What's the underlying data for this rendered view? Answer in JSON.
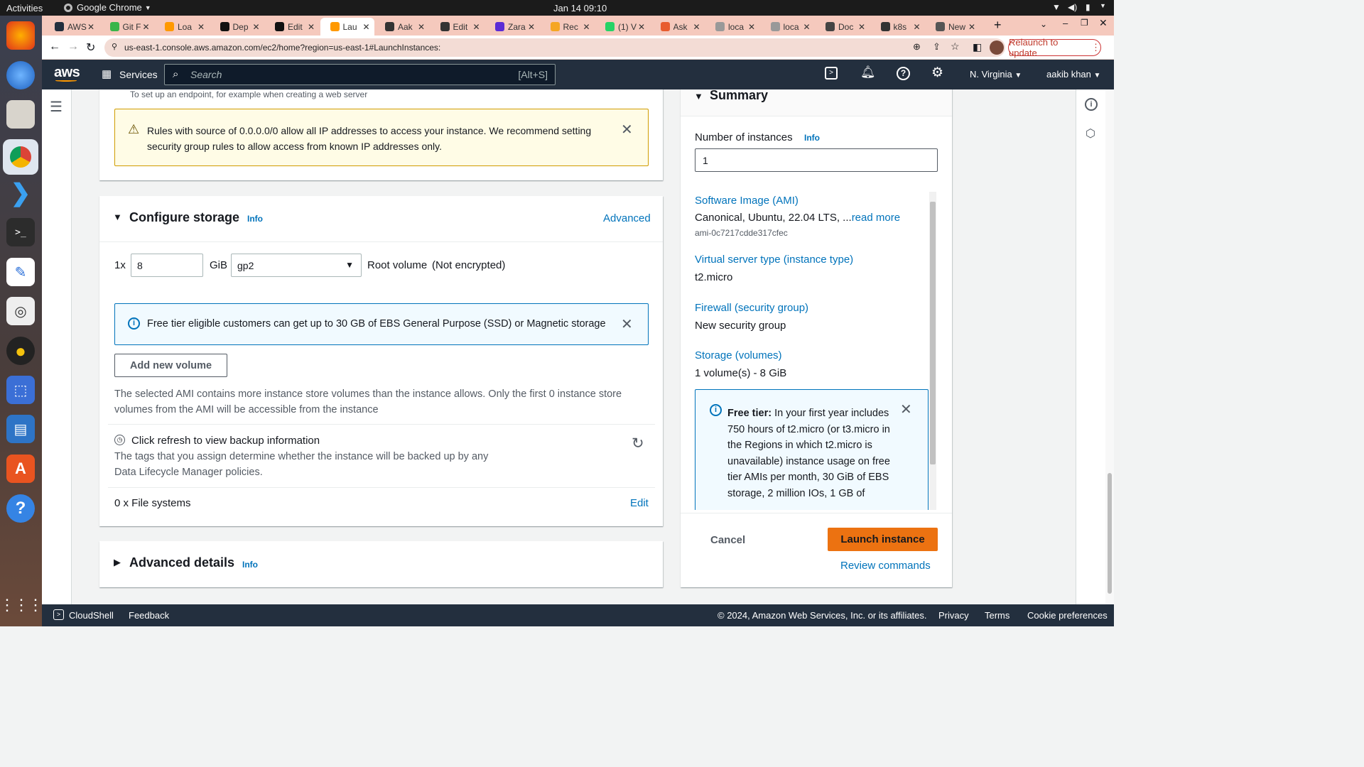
{
  "os": {
    "activities": "Activities",
    "app_name": "Google Chrome",
    "clock": "Jan 14  09:10"
  },
  "browser": {
    "tabs": [
      {
        "label": "AWS",
        "color": "#232f3e"
      },
      {
        "label": "Git F",
        "color": "#39b54a"
      },
      {
        "label": "Loa",
        "color": "#ff9900"
      },
      {
        "label": "Dep",
        "color": "#111111"
      },
      {
        "label": "Edit",
        "color": "#111111"
      },
      {
        "label": "Lau",
        "color": "#ff9900"
      },
      {
        "label": "Aak",
        "color": "#333333"
      },
      {
        "label": "Edit",
        "color": "#333333"
      },
      {
        "label": "Zara",
        "color": "#5b2bd5"
      },
      {
        "label": "Rec",
        "color": "#f5a623"
      },
      {
        "label": "(1) V",
        "color": "#25d366"
      },
      {
        "label": "Ask",
        "color": "#e85c2f"
      },
      {
        "label": "loca",
        "color": "#999999"
      },
      {
        "label": "loca",
        "color": "#999999"
      },
      {
        "label": "Doc",
        "color": "#444444"
      },
      {
        "label": "k8s",
        "color": "#333333"
      },
      {
        "label": "New",
        "color": "#555555"
      }
    ],
    "url": "us-east-1.console.aws.amazon.com/ec2/home?region=us-east-1#LaunchInstances:",
    "relaunch_label": "Relaunch to update"
  },
  "aws_nav": {
    "logo": "aws",
    "services_label": "Services",
    "search_placeholder": "Search",
    "search_shortcut": "[Alt+S]",
    "region": "N. Virginia",
    "user": "aakib khan"
  },
  "network_section": {
    "endpoint_note": "To set up an endpoint, for example when creating a web server",
    "warning_text": "Rules with source of 0.0.0.0/0 allow all IP addresses to access your instance. We recommend setting security group rules to allow access from known IP addresses only."
  },
  "storage": {
    "title": "Configure storage",
    "info_label": "Info",
    "advanced_label": "Advanced",
    "count_label": "1x",
    "size_value": "8",
    "unit_label": "GiB",
    "volume_type": "gp2",
    "root_volume_label": "Root volume",
    "encryption_label": "(Not encrypted)",
    "free_tier_note": "Free tier eligible customers can get up to 30 GB of EBS General Purpose (SSD) or Magnetic storage",
    "add_volume_label": "Add new volume",
    "ami_note": "The selected AMI contains more instance store volumes than the instance allows. Only the first 0 instance store volumes from the AMI will be accessible from the instance",
    "backup_title": "Click refresh to view backup information",
    "backup_desc": "The tags that you assign determine whether the instance will be backed up by any Data Lifecycle Manager policies.",
    "file_systems_label": "0 x File systems",
    "edit_label": "Edit"
  },
  "advanced_details": {
    "title": "Advanced details",
    "info_label": "Info"
  },
  "summary": {
    "title": "Summary",
    "instances_label": "Number of instances",
    "info_label": "Info",
    "instances_value": "1",
    "ami_label": "Software Image (AMI)",
    "ami_value": "Canonical, Ubuntu, 22.04 LTS, ...",
    "read_more": "read more",
    "ami_id": "ami-0c7217cdde317cfec",
    "instance_type_label": "Virtual server type (instance type)",
    "instance_type_value": "t2.micro",
    "firewall_label": "Firewall (security group)",
    "firewall_value": "New security group",
    "storage_label": "Storage (volumes)",
    "storage_value": "1 volume(s) - 8 GiB",
    "free_tier_title": "Free tier:",
    "free_tier_text": "In your first year includes 750 hours of t2.micro (or t3.micro in the Regions in which t2.micro is unavailable) instance usage on free tier AMIs per month, 30 GiB of EBS storage, 2 million IOs, 1 GB of",
    "cancel_label": "Cancel",
    "launch_label": "Launch instance",
    "review_label": "Review commands"
  },
  "footer": {
    "cloudshell": "CloudShell",
    "feedback": "Feedback",
    "copyright": "© 2024, Amazon Web Services, Inc. or its affiliates.",
    "privacy": "Privacy",
    "terms": "Terms",
    "cookies": "Cookie preferences"
  },
  "colors": {
    "accent_orange": "#ec7211",
    "link_blue": "#0073bb",
    "nav_dark": "#232f3e"
  }
}
